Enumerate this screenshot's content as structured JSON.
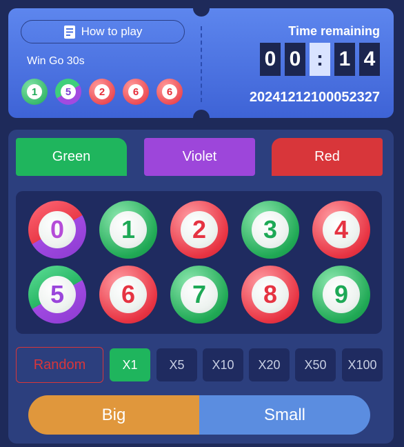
{
  "header": {
    "how_to_play_label": "How to play",
    "game_name": "Win Go 30s",
    "recent_results": [
      {
        "number": "1",
        "color": "green"
      },
      {
        "number": "5",
        "color": "green-violet"
      },
      {
        "number": "2",
        "color": "red"
      },
      {
        "number": "6",
        "color": "red"
      },
      {
        "number": "6",
        "color": "red"
      }
    ],
    "time_label": "Time remaining",
    "timer": {
      "d1": "0",
      "d2": "0",
      "sep": ":",
      "d3": "1",
      "d4": "4"
    },
    "period": "20241212100052327"
  },
  "color_bets": {
    "green": "Green",
    "violet": "Violet",
    "red": "Red"
  },
  "numbers": [
    {
      "n": "0",
      "color": "red-violet"
    },
    {
      "n": "1",
      "color": "green"
    },
    {
      "n": "2",
      "color": "red"
    },
    {
      "n": "3",
      "color": "green"
    },
    {
      "n": "4",
      "color": "red"
    },
    {
      "n": "5",
      "color": "green-violet"
    },
    {
      "n": "6",
      "color": "red"
    },
    {
      "n": "7",
      "color": "green"
    },
    {
      "n": "8",
      "color": "red"
    },
    {
      "n": "9",
      "color": "green"
    }
  ],
  "multipliers": {
    "random_label": "Random",
    "options": [
      "X1",
      "X5",
      "X10",
      "X20",
      "X50",
      "X100"
    ],
    "selected": "X1"
  },
  "size_bets": {
    "big": "Big",
    "small": "Small"
  },
  "colors": {
    "green": "#1fb55d",
    "violet": "#9d46da",
    "red": "#d8363a",
    "big": "#e0973c",
    "small": "#5b8de0"
  }
}
